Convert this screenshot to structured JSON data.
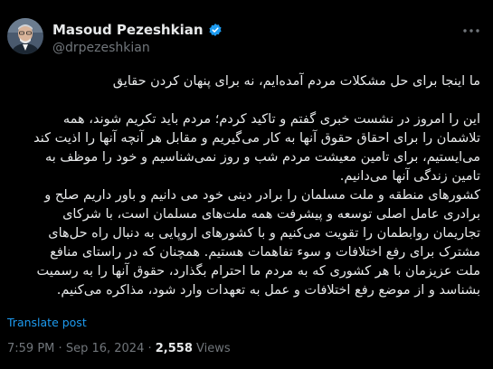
{
  "author": {
    "display_name": "Masoud Pezeshkian",
    "handle": "@drpezeshkian",
    "verified_color": "#1d9bf0"
  },
  "tweet": {
    "headline": "ما اینجا برای حل مشکلات مردم آمده‌ایم، نه برای پنهان کردن حقایق",
    "paragraph_1": "این را امروز در نشست خبری گفتم و تاکید کردم؛ مردم باید تکریم شوند، همه تلاشمان را برای احقاق حقوق آنها به کار می‌گیریم و مقابل هر آنچه آنها را اذیت کند می‌ایستیم، برای تامین معیشت مردم شب و روز نمی‌شناسیم و خود را موظف به تامین زندگی آنها می‌دانیم.",
    "paragraph_2": "کشورهای منطقه و ملت مسلمان را برادر دینی خود می دانیم و باور داریم صلح و برادری عامل اصلی توسعه و پیشرفت همه ملت‌های مسلمان است، با شرکای تجاریمان روابطمان را تقویت می‌کنیم و با کشورهای اروپایی به دنبال راه حل‌های مشترک برای رفع اختلافات و سوء تفاهمات هستیم. همچنان که در راستای منافع ملت عزیزمان با هر کشوری که به مردم ما احترام بگذارد، حقوق آنها را به رسمیت بشناسد و از موضع رفع اختلافات و عمل به تعهدات وارد شود، مذاکره می‌کنیم."
  },
  "actions": {
    "translate_label": "Translate post"
  },
  "meta": {
    "time": "7:59 PM",
    "separator": "·",
    "date": "Sep 16, 2024",
    "views_count": "2,558",
    "views_label": "Views"
  },
  "colors": {
    "background": "#000000",
    "text": "#e7e9ea",
    "secondary": "#71767b",
    "accent": "#1d9bf0"
  }
}
